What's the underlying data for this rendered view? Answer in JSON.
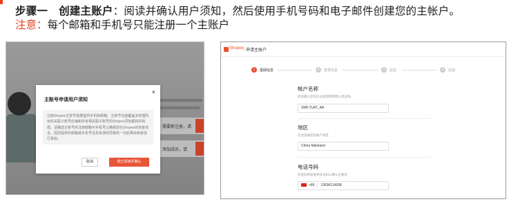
{
  "header": {
    "step_label": "步骤一",
    "step_title": "创建主账户",
    "step_desc": "：阅读并确认用户须知，然后使用手机号码和电子邮件创建您的主帐户。",
    "note_label": "注意：",
    "note_text": "每个邮箱和手机号只能注册一个主账户"
  },
  "left_screenshot": {
    "background": {
      "card1_text": "需要新注册，请",
      "card2_text": "添加成员，请"
    },
    "modal": {
      "title": "主账号申请用户须知",
      "close_glyph": "×",
      "body": "注册Shopee主账号需要提供手机和邮箱。主账号功能覆盖多管理所有的关联子账号店铺和所有相关联子账号的Shopee须包都获的权限。请确选主账号的注册邮箱与手机号以确保您在Shopee的资金安全。因您提供的邮箱或手机号信息有误而导致的一切后果由卖家自行承担。",
      "cancel_label": "取消",
      "confirm_label": "我已阅读并确认"
    }
  },
  "right_screenshot": {
    "brand": "Shopee",
    "app_title": "申请主账户",
    "steps": [
      {
        "num": "1",
        "label": "基础信息",
        "active": true
      },
      {
        "num": "2",
        "label": "登录信息",
        "active": false
      },
      {
        "num": "3",
        "label": "验证",
        "active": false
      },
      {
        "num": "4",
        "label": "完成",
        "active": false
      }
    ],
    "account_name": {
      "title": "帐户名称",
      "hint": "你该输入您的企业名称和销售公司名称。",
      "value": "SMF.7UAT_AA"
    },
    "region": {
      "title": "地区",
      "hint": "在此选择您的帐户地区",
      "value": "China Mainland"
    },
    "phone": {
      "title": "电话号码",
      "hint": "验证码将发送到该号码以确认主账号",
      "code": "+86",
      "value": "13690114938"
    }
  },
  "colors": {
    "accent": "#e8421f",
    "shopee": "#ee4d2d"
  }
}
